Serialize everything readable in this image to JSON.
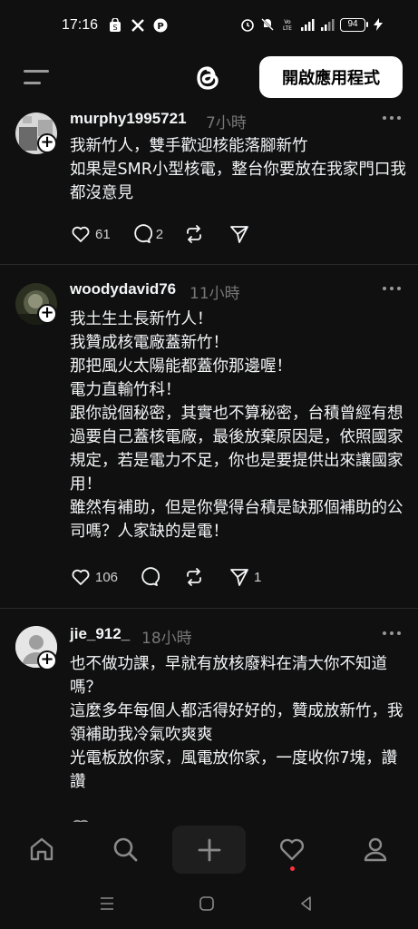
{
  "status_bar": {
    "time": "17:16",
    "battery": "94",
    "left_icons": [
      "shop-icon",
      "x-icon",
      "p-icon"
    ],
    "right_icons": [
      "alarm-icon",
      "mute-icon",
      "volte-icon",
      "4g-signal-icon",
      "signal-icon",
      "battery-icon",
      "charging-icon"
    ]
  },
  "header": {
    "logo": "threads-logo",
    "open_app_label": "開啟應用程式"
  },
  "posts": [
    {
      "username": "murphy1995721",
      "time": "7小時",
      "text": "我新竹人，雙手歡迎核能落腳新竹\n如果是SMR小型核電，整台你要放在我家門口我都沒意見",
      "likes": "61",
      "replies": "2",
      "reposts": "",
      "shares": ""
    },
    {
      "username": "woodydavid76",
      "time": "11小時",
      "text": "我土生土長新竹人！\n我贊成核電廠蓋新竹！\n那把風火太陽能都蓋你那邊喔！\n電力直輸竹科！\n跟你說個秘密，其實也不算秘密，台積曾經有想過要自己蓋核電廠，最後放棄原因是，依照國家規定，若是電力不足，你也是要提供出來讓國家用！\n雖然有補助，但是你覺得台積是缺那個補助的公司嗎？人家缺的是電！",
      "likes": "106",
      "replies": "",
      "reposts": "",
      "shares": "1"
    },
    {
      "username": "jie_912_",
      "time": "18小時",
      "text": "也不做功課，早就有放核廢料在清大你不知道嗎？\n這麼多年每個人都活得好好的，贊成放新竹，我領補助我冷氣吹爽爽\n光電板放你家，風電放你家，一度收你7塊，讚讚",
      "likes": "",
      "replies": "",
      "reposts": "",
      "shares": ""
    }
  ],
  "bottom_nav": [
    "home-icon",
    "search-icon",
    "create-icon",
    "activity-icon",
    "profile-icon"
  ],
  "system_nav": [
    "recents-icon",
    "home-circle-icon",
    "back-icon"
  ],
  "colors": {
    "background": "#101010",
    "text": "#f3f5f7",
    "muted": "#777777",
    "divider": "#2a2a2a",
    "accent_dot": "#ff3040"
  }
}
